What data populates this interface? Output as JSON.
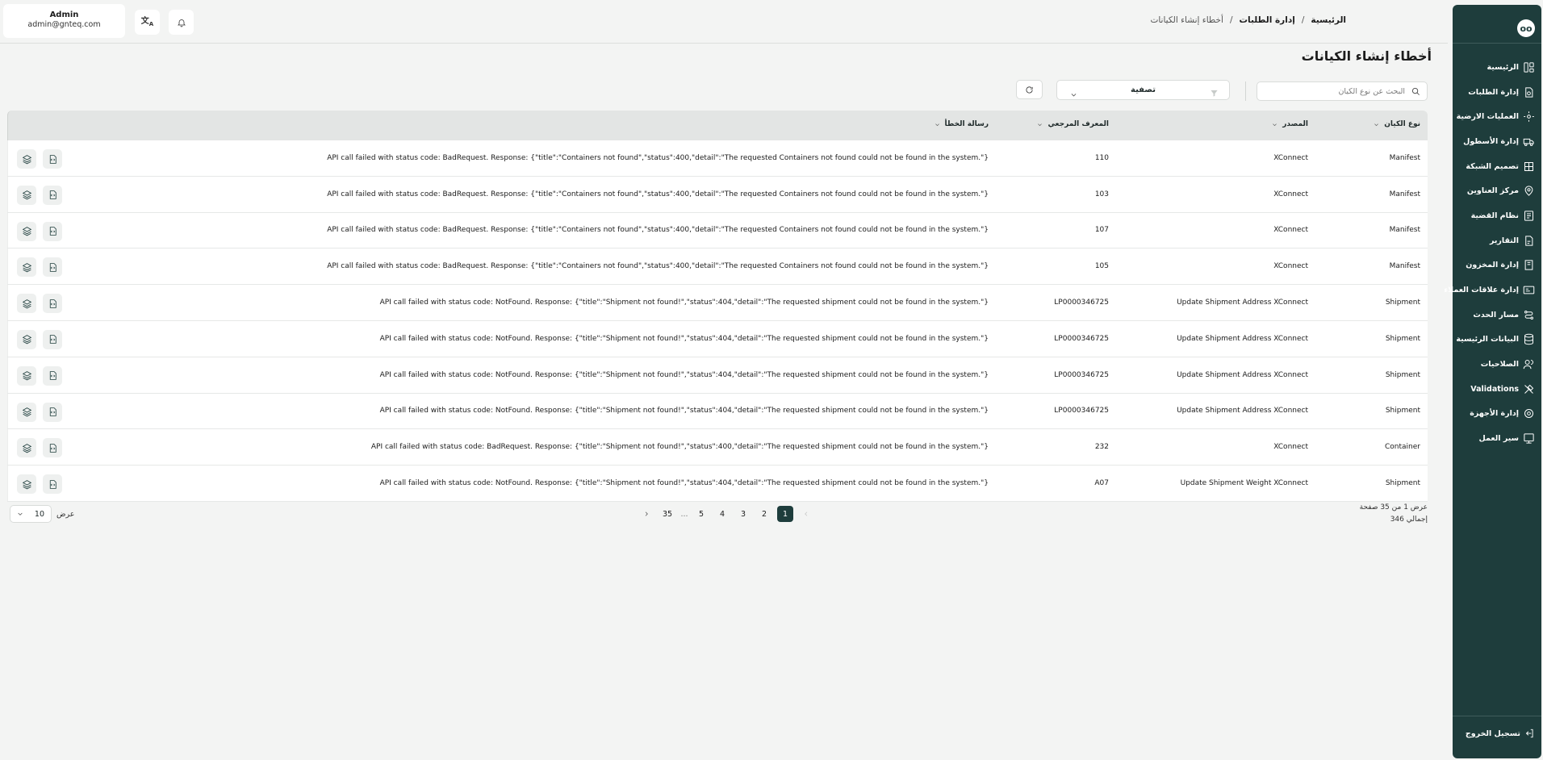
{
  "header": {
    "user_name": "Admin",
    "user_email": "admin@gnteq.com",
    "breadcrumb": {
      "home": "الرئيسية",
      "section": "إدارة الطلبات",
      "current": "أخطاء إنشاء الكيانات",
      "separator": "/"
    }
  },
  "page_title": "أخطاء إنشاء الكيانات",
  "toolbar": {
    "search_placeholder": "البحث عن نوع الكيان",
    "filter_label": "تصفية"
  },
  "sidebar": {
    "logo": "oo",
    "items": [
      {
        "label": "الرئيسية",
        "icon": "dashboard-icon"
      },
      {
        "label": "إدارة الطلبات",
        "icon": "orders-icon"
      },
      {
        "label": "العمليات الارضية",
        "icon": "ground-ops-icon"
      },
      {
        "label": "إدارة الأسطول",
        "icon": "truck-icon"
      },
      {
        "label": "تصميم الشبكة",
        "icon": "network-icon"
      },
      {
        "label": "مركز العناوين",
        "icon": "location-icon"
      },
      {
        "label": "نظام القضية",
        "icon": "case-icon"
      },
      {
        "label": "التقارير",
        "icon": "report-icon"
      },
      {
        "label": "إدارة المخزون",
        "icon": "inventory-icon"
      },
      {
        "label": "إدارة علاقات العملاء",
        "icon": "crm-icon"
      },
      {
        "label": "مسار الحدث",
        "icon": "route-icon"
      },
      {
        "label": "البيانات الرئيسية",
        "icon": "database-icon"
      },
      {
        "label": "الصلاحيات",
        "icon": "users-icon"
      },
      {
        "label": "Validations",
        "icon": "tools-icon"
      },
      {
        "label": "إدارة الأجهزة",
        "icon": "device-icon"
      },
      {
        "label": "سير العمل",
        "icon": "workflow-icon"
      }
    ],
    "logout_label": "تسجيل الخروج"
  },
  "table": {
    "columns": {
      "type": "نوع الكيان",
      "source": "المصدر",
      "ref": "المعرف المرجعي",
      "message": "رسالة الخطأ"
    },
    "rows": [
      {
        "type": "Manifest",
        "source": "XConnect",
        "ref": "110",
        "message": "API call failed with status code: BadRequest. Response: {\"title\":\"Containers not found\",\"status\":400,\"detail\":\"The requested Containers not found could not be found in the system.\"}"
      },
      {
        "type": "Manifest",
        "source": "XConnect",
        "ref": "103",
        "message": "API call failed with status code: BadRequest. Response: {\"title\":\"Containers not found\",\"status\":400,\"detail\":\"The requested Containers not found could not be found in the system.\"}"
      },
      {
        "type": "Manifest",
        "source": "XConnect",
        "ref": "107",
        "message": "API call failed with status code: BadRequest. Response: {\"title\":\"Containers not found\",\"status\":400,\"detail\":\"The requested Containers not found could not be found in the system.\"}"
      },
      {
        "type": "Manifest",
        "source": "XConnect",
        "ref": "105",
        "message": "API call failed with status code: BadRequest. Response: {\"title\":\"Containers not found\",\"status\":400,\"detail\":\"The requested Containers not found could not be found in the system.\"}"
      },
      {
        "type": "Shipment",
        "source": "Update Shipment Address XConnect",
        "ref": "LP0000346725",
        "message": "API call failed with status code: NotFound. Response: {\"title\":\"Shipment not found!\",\"status\":404,\"detail\":\"The requested shipment could not be found in the system.\"}"
      },
      {
        "type": "Shipment",
        "source": "Update Shipment Address XConnect",
        "ref": "LP0000346725",
        "message": "API call failed with status code: NotFound. Response: {\"title\":\"Shipment not found!\",\"status\":404,\"detail\":\"The requested shipment could not be found in the system.\"}"
      },
      {
        "type": "Shipment",
        "source": "Update Shipment Address XConnect",
        "ref": "LP0000346725",
        "message": "API call failed with status code: NotFound. Response: {\"title\":\"Shipment not found!\",\"status\":404,\"detail\":\"The requested shipment could not be found in the system.\"}"
      },
      {
        "type": "Shipment",
        "source": "Update Shipment Address XConnect",
        "ref": "LP0000346725",
        "message": "API call failed with status code: NotFound. Response: {\"title\":\"Shipment not found!\",\"status\":404,\"detail\":\"The requested shipment could not be found in the system.\"}"
      },
      {
        "type": "Container",
        "source": "XConnect",
        "ref": "232",
        "message": "API call failed with status code: BadRequest. Response: {\"title\":\"Shipment not found!\",\"status\":400,\"detail\":\"The requested shipment could not be found in the system.\"}"
      },
      {
        "type": "Shipment",
        "source": "Update Shipment Weight XConnect",
        "ref": "A07",
        "message": "API call failed with status code: NotFound. Response: {\"title\":\"Shipment not found!\",\"status\":404,\"detail\":\"The requested shipment could not be found in the system.\"}"
      }
    ]
  },
  "pagination": {
    "summary_pages": "عرض 1 من 35 صفحة",
    "summary_total": "إجمالي 346",
    "pages": [
      "1",
      "2",
      "3",
      "4",
      "5",
      "...",
      "35"
    ],
    "active_page": "1",
    "page_size_label": "عرض",
    "page_size": "10"
  }
}
